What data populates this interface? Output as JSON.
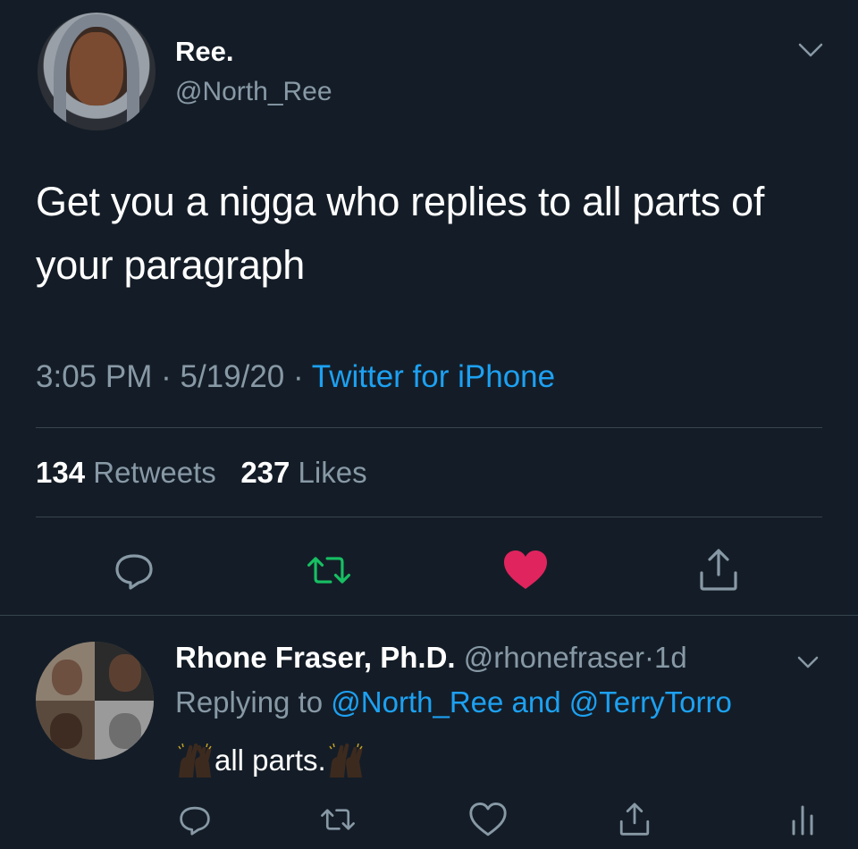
{
  "tweet": {
    "display_name": "Ree.",
    "handle": "@North_Ree",
    "text": "Get you a nigga who replies to all parts of your paragraph",
    "time": "3:05 PM",
    "date": "5/19/20",
    "separator": "·",
    "source": "Twitter for iPhone",
    "retweet_count": "134",
    "retweet_label": "Retweets",
    "like_count": "237",
    "like_label": "Likes",
    "liked": true,
    "colors": {
      "retweet": "#17bf63",
      "like": "#e0245e",
      "link": "#1da1f2",
      "muted": "#8899a6"
    },
    "actions": [
      "reply-icon",
      "retweet-icon",
      "like-icon",
      "share-icon"
    ]
  },
  "reply": {
    "display_name": "Rhone Fraser, Ph.D.",
    "handle": "@rhonefraser",
    "separator": "·",
    "age": "1d",
    "replying_label": "Replying to",
    "mention_1": "@North_Ree",
    "and_label": "and",
    "mention_2": "@TerryTorro",
    "text": "all parts.",
    "emoji": "raising-hands-dark-skin",
    "actions": [
      "reply-icon",
      "retweet-icon",
      "like-icon",
      "share-icon",
      "analytics-icon"
    ]
  }
}
